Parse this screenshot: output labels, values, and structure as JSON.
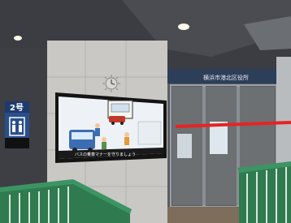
{
  "scene": {
    "station_sign": {
      "label": "2号",
      "sublabel": "エレベーター"
    },
    "door_sign_text": "横浜市港北区役所",
    "screen": {
      "caption": "バスの乗車マナーを守りましょう"
    },
    "colors": {
      "ceiling": "#3b3d42",
      "tile_wall": "#c9c8c4",
      "screen_bezel": "#141414",
      "screen_bg": "#eef2f6",
      "red_line": "#e52424",
      "railing": "#2f7a4f",
      "sign_blue": "#2a4e8c"
    },
    "icons": [
      "ceiling-light-icon",
      "wall-clock-icon",
      "elevator-icon",
      "bus-icon"
    ]
  }
}
